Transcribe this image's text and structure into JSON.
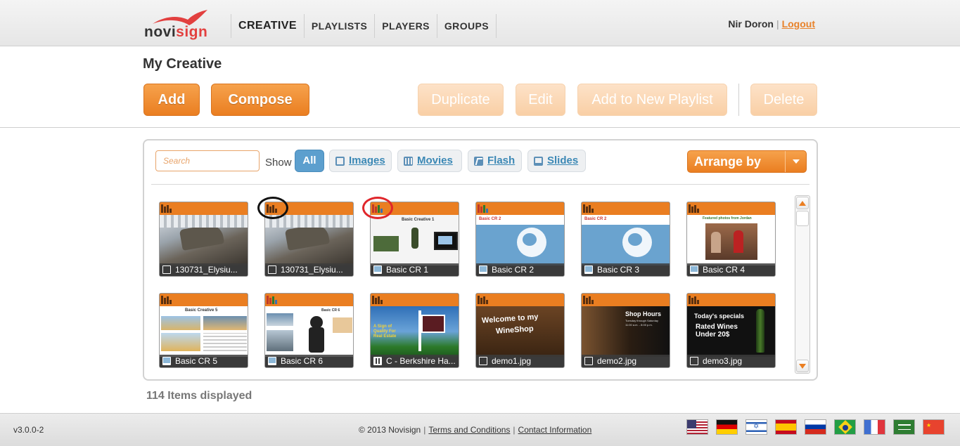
{
  "brand": {
    "logo_text_a": "novi",
    "logo_text_b": "sign",
    "accent": "#ea7e21",
    "logo_red": "#e2403f"
  },
  "nav": {
    "items": [
      {
        "label": "CREATIVE",
        "active": true
      },
      {
        "label": "PLAYLISTS",
        "active": false
      },
      {
        "label": "PLAYERS",
        "active": false
      },
      {
        "label": "GROUPS",
        "active": false
      }
    ]
  },
  "user": {
    "name": "Nir Doron",
    "separator": "|",
    "logout": "Logout"
  },
  "page": {
    "title": "My Creative"
  },
  "toolbar": {
    "add": "Add",
    "compose": "Compose",
    "duplicate": "Duplicate",
    "edit": "Edit",
    "add_to_playlist": "Add to New Playlist",
    "delete": "Delete"
  },
  "filters": {
    "search_placeholder": "Search",
    "show_label": "Show",
    "all": "All",
    "images": "Images",
    "movies": "Movies",
    "flash": "Flash",
    "slides": "Slides",
    "arrange": "Arrange by"
  },
  "tiles": [
    {
      "name": "130731_Elysiu...",
      "type": "image",
      "thumb": "tank"
    },
    {
      "name": "130731_Elysiu...",
      "type": "image",
      "thumb": "tank"
    },
    {
      "name": "Basic CR 1",
      "type": "slide",
      "thumb": "cr1"
    },
    {
      "name": "Basic CR 2",
      "type": "slide",
      "thumb": "globe"
    },
    {
      "name": "Basic CR 3",
      "type": "slide",
      "thumb": "globe"
    },
    {
      "name": "Basic CR 4",
      "type": "slide",
      "thumb": "people"
    },
    {
      "name": "Basic CR 5",
      "type": "slide",
      "thumb": "desert"
    },
    {
      "name": "Basic CR 6",
      "type": "slide",
      "thumb": "cr6"
    },
    {
      "name": "C - Berkshire Ha...",
      "type": "movie",
      "thumb": "sky"
    },
    {
      "name": "demo1.jpg",
      "type": "image",
      "thumb": "wine"
    },
    {
      "name": "demo2.jpg",
      "type": "image",
      "thumb": "hours"
    },
    {
      "name": "demo3.jpg",
      "type": "image",
      "thumb": "specials"
    }
  ],
  "thumb_text": {
    "cr1_title": "Basic Creative 1",
    "cr2_title": "Basic CR 2",
    "cr5_title": "Basic Creative 5",
    "cr6_title": "Basic CR 6",
    "people_title": "Featured photos from Jordan",
    "sky_text": "A Sign of Quality For Real Estate",
    "wine_line1": "Welcome to my",
    "wine_line2": "WineShop",
    "hours_title": "Shop Hours",
    "hours_line1": "Tuesday through Saturday",
    "hours_line2": "11:00 a.m. - 8:00 p.m.",
    "specials_title": "Today's specials",
    "specials_line1": "Rated Wines",
    "specials_line2": "Under 20$"
  },
  "status": {
    "count": "114 Items displayed"
  },
  "footer": {
    "version": "v3.0.0-2",
    "copyright": "© 2013 Novisign",
    "terms": "Terms and Conditions",
    "contact": "Contact Information",
    "flags": [
      "us",
      "de",
      "il",
      "es",
      "ru",
      "br",
      "fr",
      "sa",
      "cn"
    ]
  }
}
